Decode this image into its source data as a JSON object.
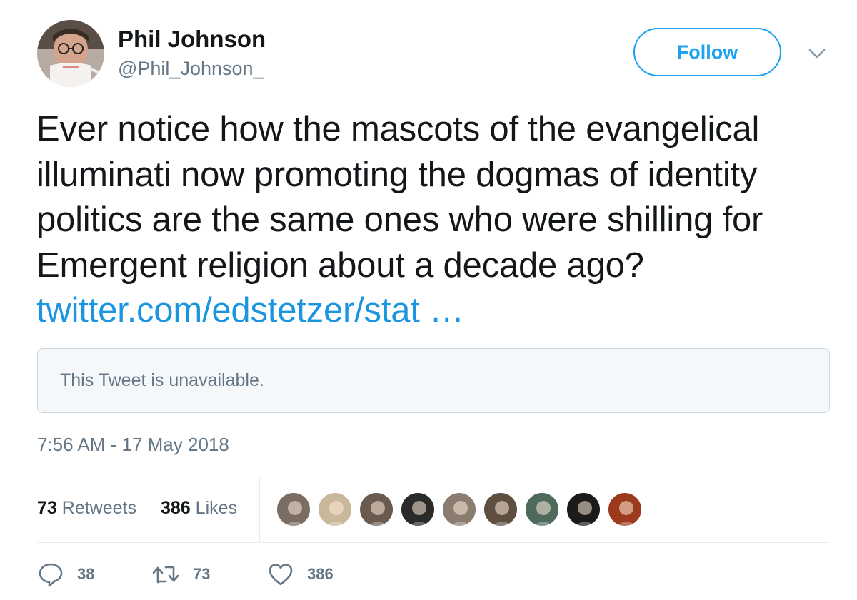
{
  "user": {
    "name": "Phil Johnson",
    "handle": "@Phil_Johnson_"
  },
  "follow_button": {
    "label": "Follow"
  },
  "tweet": {
    "text": "Ever notice how the mascots of the evangelical illuminati now promoting the dogmas of identity politics are the same ones who were shilling for Emergent religion about a decade ago?",
    "link_text": "twitter.com/edstetzer/stat …"
  },
  "quoted_tweet": {
    "text": "This Tweet is unavailable."
  },
  "timestamp": "7:56 AM - 17 May 2018",
  "stats": {
    "retweets_count": "73",
    "retweets_label": "Retweets",
    "likes_count": "386",
    "likes_label": "Likes"
  },
  "liker_avatars": [
    {
      "name": "liker-avatar-1",
      "color": "#7a6e64"
    },
    {
      "name": "liker-avatar-2",
      "color": "#c9b89a"
    },
    {
      "name": "liker-avatar-3",
      "color": "#6b5a4e"
    },
    {
      "name": "liker-avatar-4",
      "color": "#2a2a2a"
    },
    {
      "name": "liker-avatar-5",
      "color": "#8a7d70"
    },
    {
      "name": "liker-avatar-6",
      "color": "#5e4f40"
    },
    {
      "name": "liker-avatar-7",
      "color": "#4d6a5c"
    },
    {
      "name": "liker-avatar-8",
      "color": "#1b1b1b"
    },
    {
      "name": "liker-avatar-9",
      "color": "#9c3a1e"
    }
  ],
  "actions": {
    "reply_count": "38",
    "retweet_count": "73",
    "like_count": "386"
  },
  "colors": {
    "accent": "#1da1f2",
    "link": "#1b95e0",
    "secondary_text": "#657786",
    "border": "#e6ecf0"
  },
  "icons": [
    "chevron-down-icon",
    "reply-icon",
    "retweet-icon",
    "heart-icon"
  ]
}
